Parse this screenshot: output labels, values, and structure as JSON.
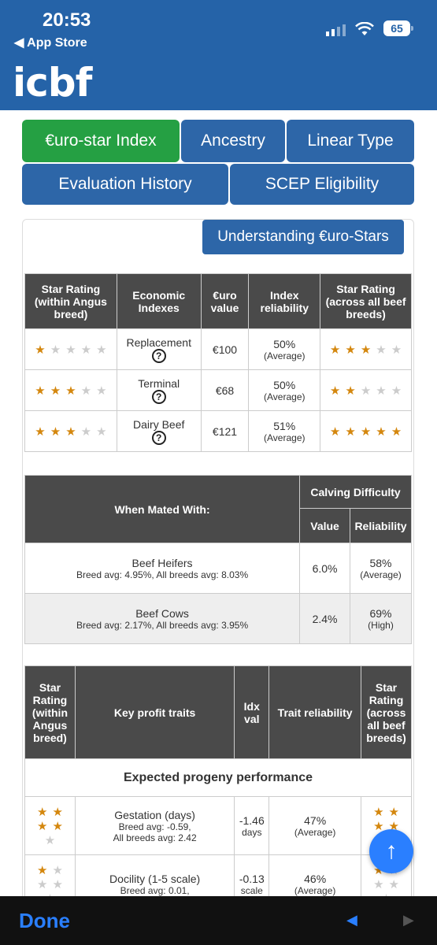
{
  "status": {
    "time": "20:53",
    "back_label": "◀ App Store",
    "battery": "65"
  },
  "logo": "icbf",
  "tabs": [
    "€uro-star Index",
    "Ancestry",
    "Linear Type",
    "Evaluation History",
    "SCEP Eligibility"
  ],
  "understanding_button": "Understanding €uro-Stars",
  "index_table": {
    "headers": [
      "Star Rating (within Angus breed)",
      "Economic Indexes",
      "€uro value",
      "Index reliability",
      "Star Rating (across all beef breeds)"
    ],
    "rows": [
      {
        "within": 1,
        "name": "Replacement",
        "value": "€100",
        "rel": "50%",
        "rel_label": "(Average)",
        "across": 3
      },
      {
        "within": 3,
        "name": "Terminal",
        "value": "€68",
        "rel": "50%",
        "rel_label": "(Average)",
        "across": 2
      },
      {
        "within": 3,
        "name": "Dairy Beef",
        "value": "€121",
        "rel": "51%",
        "rel_label": "(Average)",
        "across": 5
      }
    ]
  },
  "calving_table": {
    "mated_with": "When Mated With:",
    "title": "Calving Difficulty",
    "value_h": "Value",
    "rel_h": "Reliability",
    "rows": [
      {
        "name": "Beef Heifers",
        "avg": "Breed avg: 4.95%, All breeds avg: 8.03%",
        "value": "6.0%",
        "rel": "58%",
        "rel_label": "(Average)"
      },
      {
        "name": "Beef Cows",
        "avg": "Breed avg: 2.17%, All breeds avg: 3.95%",
        "value": "2.4%",
        "rel": "69%",
        "rel_label": "(High)"
      }
    ]
  },
  "traits_table": {
    "headers": [
      "Star Rating (within Angus breed)",
      "Key profit traits",
      "Idx val",
      "Trait reliability",
      "Star Rating (across all beef breeds)"
    ],
    "section": "Expected progeny performance",
    "rows": [
      {
        "within": 4,
        "name": "Gestation (days)",
        "avg1": "Breed avg: -0.59,",
        "avg2": "All breeds avg: 2.42",
        "val": "-1.46",
        "unit": "days",
        "rel": "47%",
        "rel_label": "(Average)",
        "across": 4
      },
      {
        "within": 1,
        "name": "Docility (1-5 scale)",
        "avg1": "Breed avg: 0.01,",
        "avg2": "",
        "val": "-0.13",
        "unit": "scale",
        "rel": "46%",
        "rel_label": "(Average)",
        "across": 1
      }
    ]
  },
  "bottom": {
    "done": "Done",
    "back_arrow": "◀",
    "fwd_arrow": "▶"
  },
  "fab": "↑"
}
